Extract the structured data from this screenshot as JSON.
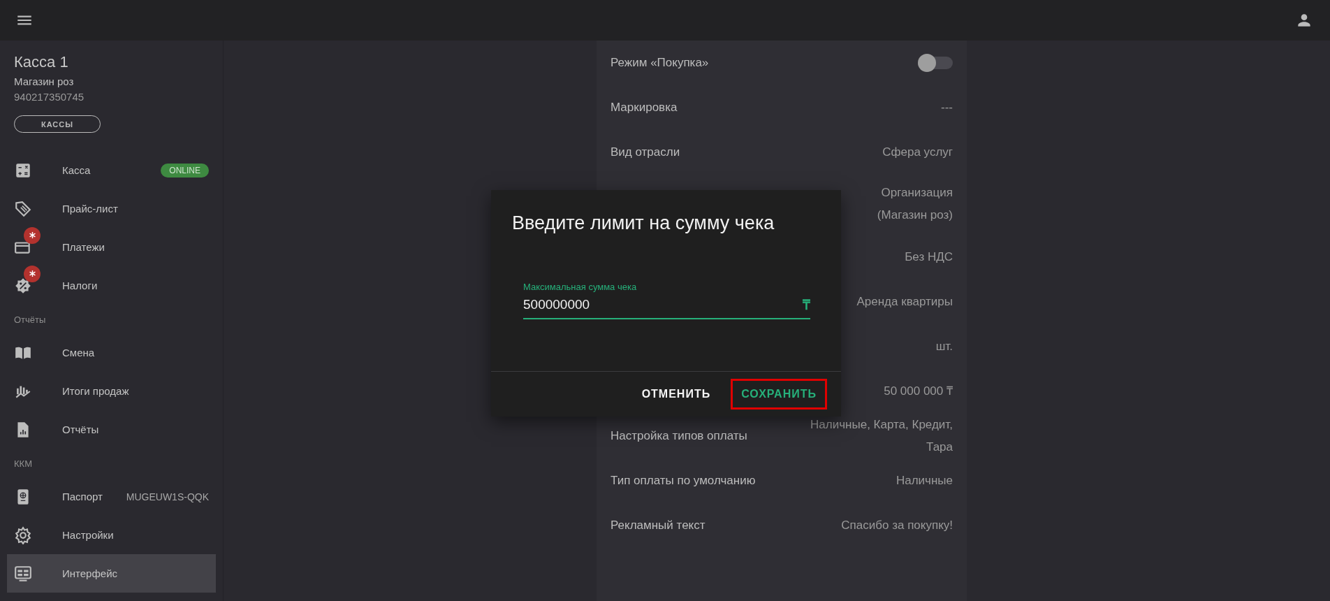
{
  "sidebar": {
    "title": "Касса 1",
    "subtitle": "Магазин роз",
    "number": "940217350745",
    "button": "КАССЫ",
    "sections": [
      {
        "items": [
          {
            "label": "Касса",
            "status": "ONLINE",
            "alert": false,
            "selected": false
          },
          {
            "label": "Прайс-лист",
            "alert": false,
            "selected": false
          },
          {
            "label": "Платежи",
            "alert": true,
            "selected": false
          },
          {
            "label": "Налоги",
            "alert": true,
            "selected": false
          }
        ]
      },
      {
        "heading": "Отчёты",
        "items": [
          {
            "label": "Смена",
            "alert": false,
            "selected": false
          },
          {
            "label": "Итоги продаж",
            "alert": false,
            "selected": false
          },
          {
            "label": "Отчёты",
            "alert": false,
            "selected": false
          }
        ]
      },
      {
        "heading": "ККМ",
        "items": [
          {
            "label": "Паспорт",
            "value": "MUGEUW1S-QQK",
            "alert": false,
            "selected": false
          },
          {
            "label": "Настройки",
            "alert": false,
            "selected": false
          },
          {
            "label": "Интерфейс",
            "alert": false,
            "selected": true
          }
        ]
      }
    ]
  },
  "settings": [
    {
      "kind": "toggle",
      "label": "Режим «Покупка»",
      "on": false
    },
    {
      "kind": "text",
      "label": "Маркировка",
      "value": "---"
    },
    {
      "kind": "text",
      "label": "Вид отрасли",
      "value": "Сфера услуг"
    },
    {
      "kind": "text",
      "value": "Организация (Магазин роз)"
    },
    {
      "kind": "text",
      "value": "Без НДС"
    },
    {
      "kind": "text",
      "value": "Аренда квартиры"
    },
    {
      "kind": "text",
      "value": "шт."
    },
    {
      "kind": "text",
      "value": "50 000 000 ₸"
    },
    {
      "kind": "text",
      "label": "Настройка типов оплаты",
      "value": "Наличные, Карта, Кредит, Тара"
    },
    {
      "kind": "text",
      "label": "Тип оплаты по умолчанию",
      "value": "Наличные"
    },
    {
      "kind": "text",
      "label": "Рекламный текст",
      "value": "Спасибо за покупку!"
    }
  ],
  "dialog": {
    "title": "Введите лимит на сумму чека",
    "field": {
      "label": "Максимальная сумма чека",
      "value": "500000000",
      "suffix": "₸"
    },
    "buttons": [
      {
        "label": "ОТМЕНИТЬ",
        "kind": "cancel",
        "highlighted": false
      },
      {
        "label": "СОХРАНИТЬ",
        "kind": "confirm",
        "highlighted": true
      }
    ]
  }
}
